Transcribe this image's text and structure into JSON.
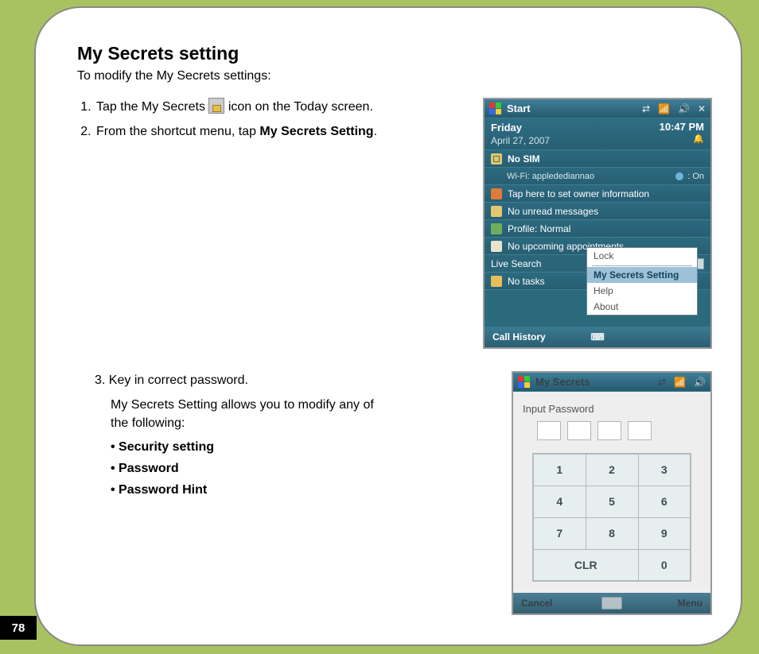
{
  "page_number": "78",
  "title": "My Secrets setting",
  "subtitle": "To modify the My Secrets settings:",
  "steps": {
    "s1a": "Tap the My Secrets ",
    "s1b": " icon on the Today screen.",
    "s2a": "From the shortcut menu, tap ",
    "s2b": "My Secrets Setting",
    "s2c": ".",
    "s3": "Key in correct password.",
    "s3_desc": "My Secrets Setting allows you to modify any of the following:"
  },
  "bullets": [
    "Security setting",
    "Password",
    "Password Hint"
  ],
  "shot1": {
    "title": "Start",
    "sys": [
      "⇄",
      "📶",
      "🔊",
      "✕"
    ],
    "day": "Friday",
    "date": "April 27, 2007",
    "time": "10:47 PM",
    "nosim": "No SIM",
    "wifi_label": "Wi-Fi: appledediannao",
    "bt_label": ": On",
    "owner": "Tap here to set owner information",
    "msgs": "No unread messages",
    "profile": "Profile: Normal",
    "appts": "No upcoming appointments",
    "livesearch": "Live Search",
    "tasks": "No tasks",
    "menu": {
      "lock": "Lock",
      "setting": "My Secrets Setting",
      "help": "Help",
      "about": "About"
    },
    "left": "Call History"
  },
  "shot2": {
    "title": "My Secrets",
    "sys": [
      "⇄",
      "📶",
      "🔊"
    ],
    "input_label": "Input Password",
    "keys": {
      "k1": "1",
      "k2": "2",
      "k3": "3",
      "k4": "4",
      "k5": "5",
      "k6": "6",
      "k7": "7",
      "k8": "8",
      "k9": "9",
      "clr": "CLR",
      "k0": "0"
    },
    "left": "Cancel",
    "right": "Menu"
  }
}
